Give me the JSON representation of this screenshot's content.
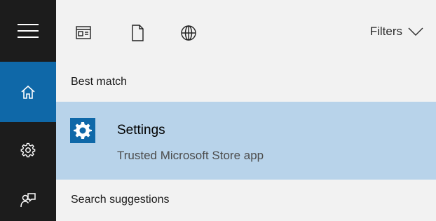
{
  "rail": {
    "menu_icon": "hamburger-menu-icon",
    "home_icon": "home-icon",
    "settings_icon": "gear-icon",
    "feedback_icon": "feedback-icon"
  },
  "topbar": {
    "apps_icon": "apps-filter-icon",
    "documents_icon": "document-icon",
    "web_icon": "globe-icon",
    "filters_label": "Filters",
    "filters_icon": "chevron-down-icon"
  },
  "best_match": {
    "heading": "Best match",
    "result": {
      "title": "Settings",
      "subtitle": "Trusted Microsoft Store app",
      "icon": "settings-gear-icon"
    }
  },
  "suggestions": {
    "heading": "Search suggestions"
  },
  "colors": {
    "rail_background": "#1c1c1c",
    "accent": "#0f68a8",
    "selected_result": "#b8d3ea",
    "panel_background": "#f2f2f2"
  }
}
